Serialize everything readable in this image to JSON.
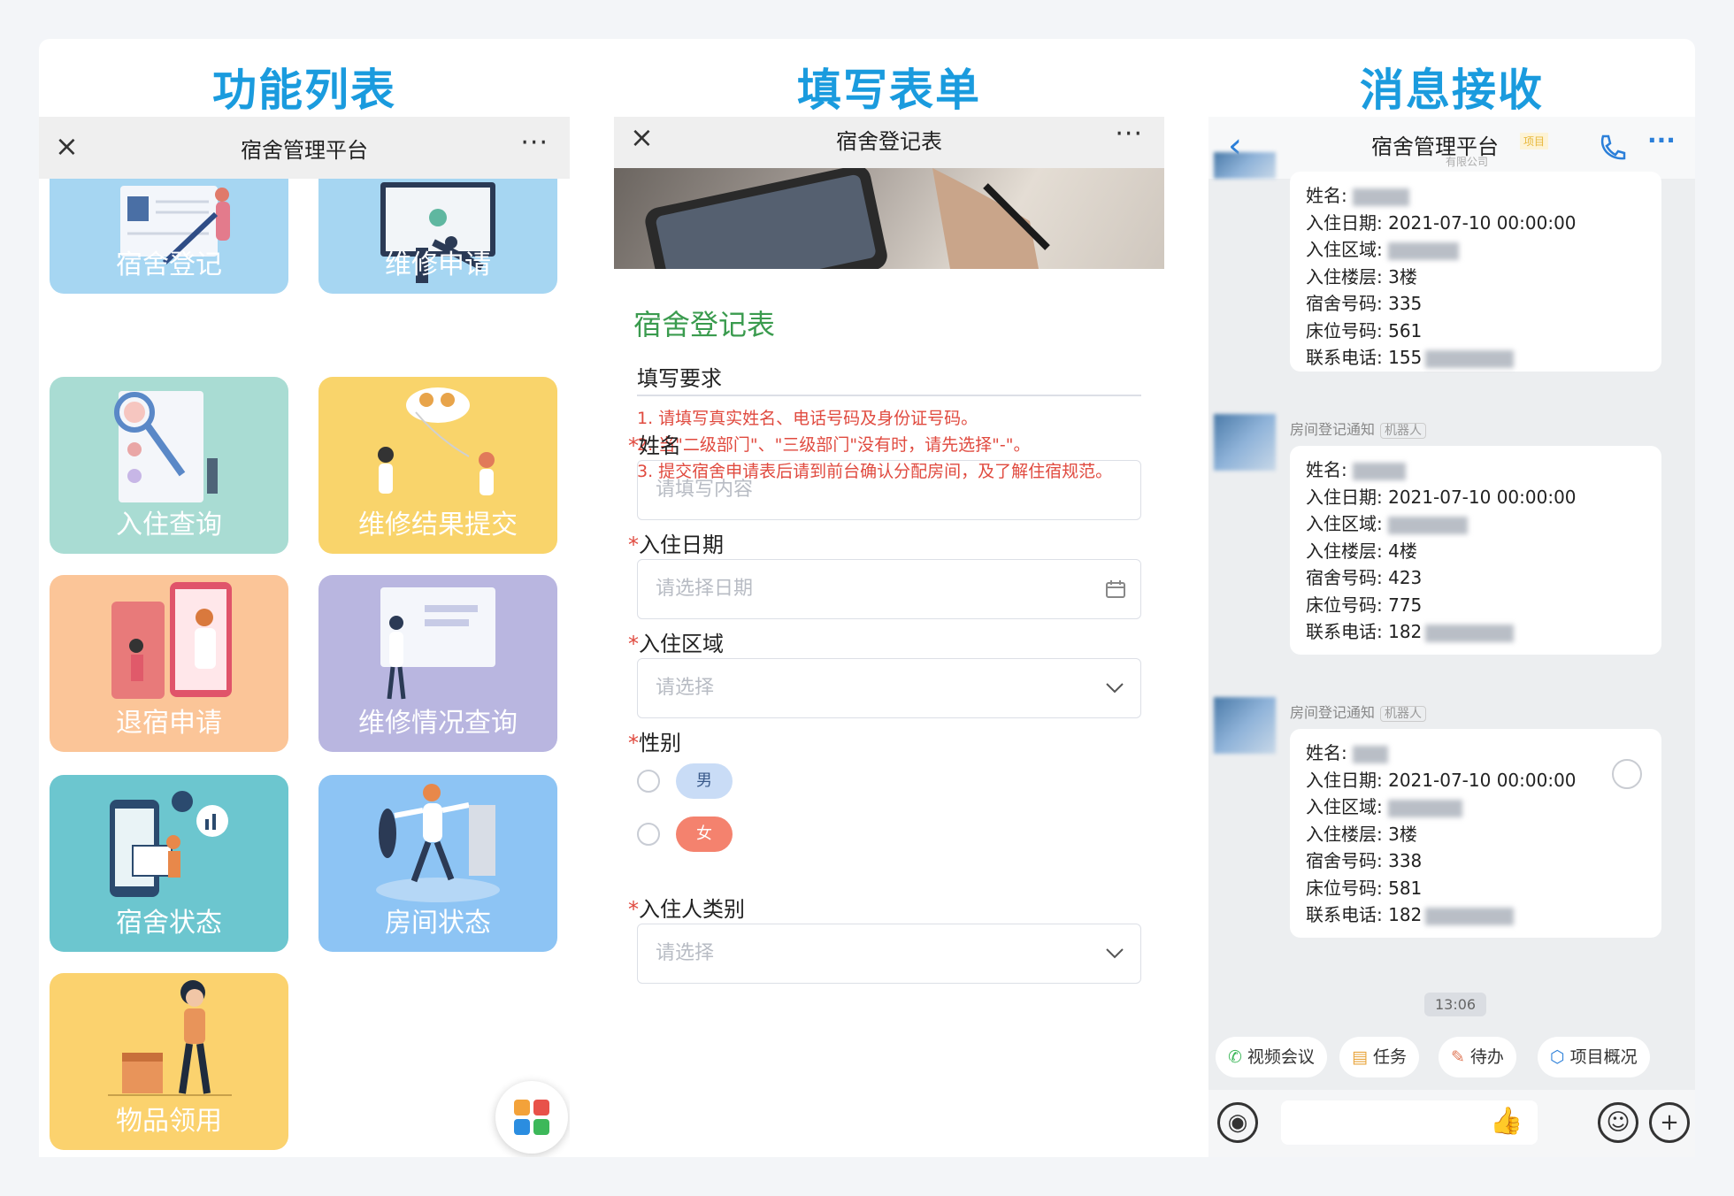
{
  "headings": {
    "col1": "功能列表",
    "col2": "填写表单",
    "col3": "消息接收"
  },
  "panel1": {
    "title": "宿舍管理平台",
    "close_icon": "×",
    "more_icon": "···",
    "tiles": [
      {
        "label": "宿舍登记",
        "color": "#a6d6f2"
      },
      {
        "label": "维修申请",
        "color": "#a6d6f2"
      },
      {
        "label": "入住查询",
        "color": "#a9dcd3"
      },
      {
        "label": "维修结果提交",
        "color": "#f9d46b"
      },
      {
        "label": "退宿申请",
        "color": "#fbc598"
      },
      {
        "label": "维修情况查询",
        "color": "#b9b6e0"
      },
      {
        "label": "宿舍状态",
        "color": "#6cc6cf"
      },
      {
        "label": "房间状态",
        "color": "#8dc4f4"
      },
      {
        "label": "物品领用",
        "color": "#fbd26e"
      }
    ]
  },
  "panel2": {
    "title": "宿舍登记表",
    "close_icon": "×",
    "more_icon": "···",
    "form_title": "宿舍登记表",
    "section_title": "填写要求",
    "requirements": [
      "1. 请填写真实姓名、电话号码及身份证号码。",
      "2. 当\"二级部门\"、\"三级部门\"没有时，请先选择\"-\"。",
      "3. 提交宿舍申请表后请到前台确认分配房间，及了解住宿规范。"
    ],
    "fields": {
      "name": {
        "label": "姓名",
        "placeholder": "请填写内容"
      },
      "date": {
        "label": "入住日期",
        "placeholder": "请选择日期"
      },
      "area": {
        "label": "入住区域",
        "placeholder": "请选择"
      },
      "gender": {
        "label": "性别",
        "options": [
          "男",
          "女"
        ]
      },
      "category": {
        "label": "入住人类别",
        "placeholder": "请选择"
      }
    },
    "required_mark": "*"
  },
  "panel3": {
    "title": "宿舍管理平台",
    "tag": "项目",
    "subtitle": "有限公司",
    "sender": "房间登记通知",
    "bot_label": "机器人",
    "labels": {
      "name": "姓名:",
      "date": "入住日期:",
      "area": "入住区域:",
      "floor": "入住楼层:",
      "room": "宿舍号码:",
      "bed": "床位号码:",
      "phone": "联系电话:"
    },
    "messages": [
      {
        "date": "2021-07-10 00:00:00",
        "floor": "3楼",
        "room": "335",
        "bed": "561",
        "phone": "155"
      },
      {
        "date": "2021-07-10 00:00:00",
        "floor": "4楼",
        "room": "423",
        "bed": "775",
        "phone": "182"
      },
      {
        "date": "2021-07-10 00:00:00",
        "floor": "3楼",
        "room": "338",
        "bed": "581",
        "phone": "182"
      }
    ],
    "time": "13:06",
    "chips": [
      "视频会议",
      "任务",
      "待办",
      "项目概况"
    ]
  }
}
